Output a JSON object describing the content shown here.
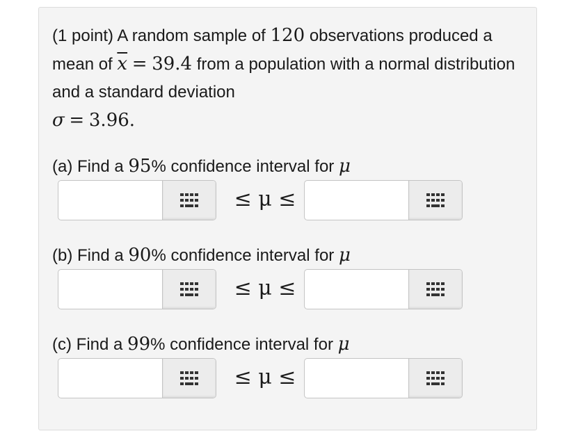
{
  "problem": {
    "points": "(1 point)",
    "text1": "A random sample of",
    "n": "120",
    "text2": "observations produced a mean of",
    "xbar": "x",
    "equals": "=",
    "mean": "39.4",
    "text3": "from a population with a normal distribution and a standard deviation",
    "sigma": "σ",
    "sd": "3.96",
    "period": "."
  },
  "parts": [
    {
      "prefix": "(a) Find a",
      "confidence": "95",
      "percent": "%",
      "suffix": "confidence interval for",
      "symbol": "μ",
      "inequality": "≤ μ ≤"
    },
    {
      "prefix": "(b) Find a",
      "confidence": "90",
      "percent": "%",
      "suffix": "confidence interval for",
      "symbol": "μ",
      "inequality": "≤ μ ≤"
    },
    {
      "prefix": "(c) Find a",
      "confidence": "99",
      "percent": "%",
      "suffix": "confidence interval for",
      "symbol": "μ",
      "inequality": "≤ μ ≤"
    }
  ],
  "inputs": {
    "a_lower": "",
    "a_upper": "",
    "b_lower": "",
    "b_upper": "",
    "c_lower": "",
    "c_upper": ""
  },
  "icons": {
    "keypad": "keypad-grid-icon"
  },
  "colors": {
    "panel_bg": "#f4f4f4",
    "panel_border": "#dcdcdc",
    "button_bg": "#ececec",
    "icon": "#333333"
  }
}
